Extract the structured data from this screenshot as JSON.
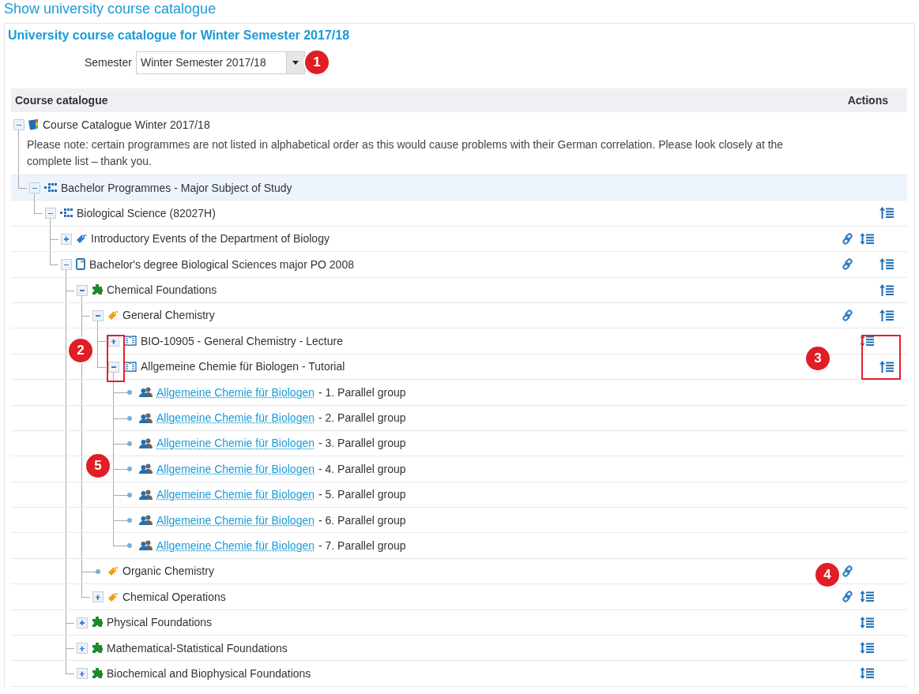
{
  "page_title": "Show university course catalogue",
  "panel_title": "University course catalogue for Winter Semester 2017/18",
  "semester": {
    "label": "Semester",
    "value": "Winter Semester 2017/18"
  },
  "table": {
    "columns": [
      "Course catalogue",
      "Actions"
    ],
    "tree": [
      {
        "kind": "catalogue",
        "label": "Course Catalogue Winter 2017/18",
        "expanded": true,
        "highlighted": false,
        "note": "Please note: certain programmes are not listed in alphabetical order as this would cause problems with their German correlation. Please look closely at the complete list – thank you.",
        "children": [
          {
            "kind": "programme",
            "label": "Bachelor Programmes - Major Subject of Study",
            "expanded": true,
            "highlighted": true,
            "children": [
              {
                "kind": "programme",
                "label": "Biological Science (82027H)",
                "expanded": true,
                "highlighted": false,
                "actions": [
                  {
                    "kind": "sort-up"
                  }
                ],
                "children": [
                  {
                    "kind": "tag",
                    "color": "#2b7bc4",
                    "label": "Introductory Events of the Department of Biology",
                    "expanded": false,
                    "highlighted": false,
                    "actions": [
                      {
                        "kind": "link"
                      },
                      {
                        "kind": "sort"
                      }
                    ]
                  },
                  {
                    "kind": "degree",
                    "label": "Bachelor's degree Biological Sciences major PO 2008",
                    "expanded": true,
                    "highlighted": false,
                    "actions": [
                      {
                        "kind": "link"
                      },
                      {
                        "kind": "sort-up"
                      }
                    ],
                    "children": [
                      {
                        "kind": "module",
                        "label": "Chemical Foundations",
                        "expanded": true,
                        "highlighted": false,
                        "actions": [
                          {
                            "kind": "sort-up"
                          }
                        ],
                        "children": [
                          {
                            "kind": "tag",
                            "color": "#f39c12",
                            "label": "General Chemistry",
                            "expanded": true,
                            "highlighted": false,
                            "actions": [
                              {
                                "kind": "link"
                              },
                              {
                                "kind": "sort-up"
                              }
                            ],
                            "children": [
                              {
                                "kind": "book",
                                "label": "BIO-10905 - General Chemistry - Lecture",
                                "expanded": false,
                                "highlighted": false,
                                "actions": [
                                  {
                                    "kind": "sort"
                                  }
                                ]
                              },
                              {
                                "kind": "book",
                                "label": "Allgemeine Chemie für Biologen - Tutorial",
                                "expanded": true,
                                "highlighted": false,
                                "actions": [
                                  {
                                    "kind": "sort-up"
                                  }
                                ],
                                "children": [
                                  {
                                    "kind": "group",
                                    "link": "Allgemeine Chemie für Biologen",
                                    "suffix": "- 1. Parallel group",
                                    "highlighted": false
                                  },
                                  {
                                    "kind": "group",
                                    "link": "Allgemeine Chemie für Biologen",
                                    "suffix": "- 2. Parallel group",
                                    "highlighted": false
                                  },
                                  {
                                    "kind": "group",
                                    "link": "Allgemeine Chemie für Biologen",
                                    "suffix": "- 3. Parallel group",
                                    "highlighted": false
                                  },
                                  {
                                    "kind": "group",
                                    "link": "Allgemeine Chemie für Biologen",
                                    "suffix": "- 4. Parallel group",
                                    "highlighted": false
                                  },
                                  {
                                    "kind": "group",
                                    "link": "Allgemeine Chemie für Biologen",
                                    "suffix": "- 5. Parallel group",
                                    "highlighted": false
                                  },
                                  {
                                    "kind": "group",
                                    "link": "Allgemeine Chemie für Biologen",
                                    "suffix": "- 6. Parallel group",
                                    "highlighted": false
                                  },
                                  {
                                    "kind": "group",
                                    "link": "Allgemeine Chemie für Biologen",
                                    "suffix": "- 7. Parallel group",
                                    "highlighted": false
                                  }
                                ]
                              }
                            ]
                          },
                          {
                            "kind": "tag",
                            "color": "#f39c12",
                            "label": "Organic Chemistry",
                            "highlighted": false,
                            "actions": [
                              {
                                "kind": "link"
                              }
                            ]
                          },
                          {
                            "kind": "tag",
                            "color": "#f39c12",
                            "label": "Chemical Operations",
                            "expanded": false,
                            "highlighted": false,
                            "actions": [
                              {
                                "kind": "link"
                              },
                              {
                                "kind": "sort"
                              }
                            ]
                          }
                        ]
                      },
                      {
                        "kind": "module",
                        "label": "Physical Foundations",
                        "expanded": false,
                        "highlighted": false,
                        "actions": [
                          {
                            "kind": "sort"
                          }
                        ]
                      },
                      {
                        "kind": "module",
                        "label": "Mathematical-Statistical Foundations",
                        "expanded": false,
                        "highlighted": false,
                        "actions": [
                          {
                            "kind": "sort"
                          }
                        ]
                      },
                      {
                        "kind": "module",
                        "label": "Biochemical and Biophysical Foundations",
                        "expanded": false,
                        "highlighted": false,
                        "actions": [
                          {
                            "kind": "sort"
                          }
                        ]
                      }
                    ]
                  }
                ]
              }
            ]
          }
        ]
      }
    ]
  },
  "callouts": [
    {
      "number": "1"
    },
    {
      "number": "2"
    },
    {
      "number": "3"
    },
    {
      "number": "4"
    },
    {
      "number": "5"
    }
  ]
}
